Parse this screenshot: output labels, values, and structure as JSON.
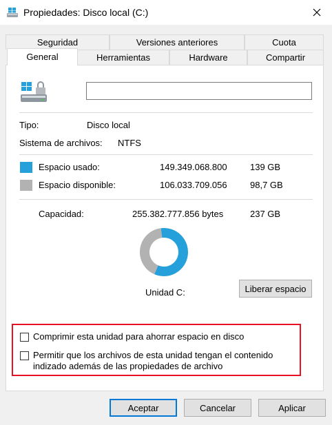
{
  "window": {
    "title": "Propiedades: Disco local (C:)",
    "icons": {
      "app": "drive-icon",
      "close": "close-icon"
    }
  },
  "tabs": {
    "row_back": [
      "Seguridad",
      "Versiones anteriores",
      "Cuota"
    ],
    "row_front": [
      "General",
      "Herramientas",
      "Hardware",
      "Compartir"
    ],
    "active": "General"
  },
  "general": {
    "drive_label_value": "",
    "type_label": "Tipo:",
    "type_value": "Disco local",
    "fs_label": "Sistema de archivos:",
    "fs_value": "NTFS",
    "used_label": "Espacio usado:",
    "used_bytes": "149.349.068.800",
    "used_size": "139 GB",
    "free_label": "Espacio disponible:",
    "free_bytes": "106.033.709.056",
    "free_size": "98,7 GB",
    "capacity_label": "Capacidad:",
    "capacity_bytes": "255.382.777.856 bytes",
    "capacity_size": "237 GB",
    "drive_caption": "Unidad C:",
    "cleanup_button": "Liberar espacio",
    "used_fraction": 0.585,
    "colors": {
      "used": "#26a0da",
      "free": "#b2b2b2",
      "highlight_border": "#e81123"
    }
  },
  "options": {
    "compress_label": "Comprimir esta unidad para ahorrar espacio en disco",
    "compress_checked": false,
    "index_label_line1": "Permitir que los archivos de esta unidad tengan el contenido",
    "index_label_line2": "indizado además de las propiedades de archivo",
    "index_checked": false
  },
  "footer": {
    "ok": "Aceptar",
    "cancel": "Cancelar",
    "apply": "Aplicar"
  }
}
